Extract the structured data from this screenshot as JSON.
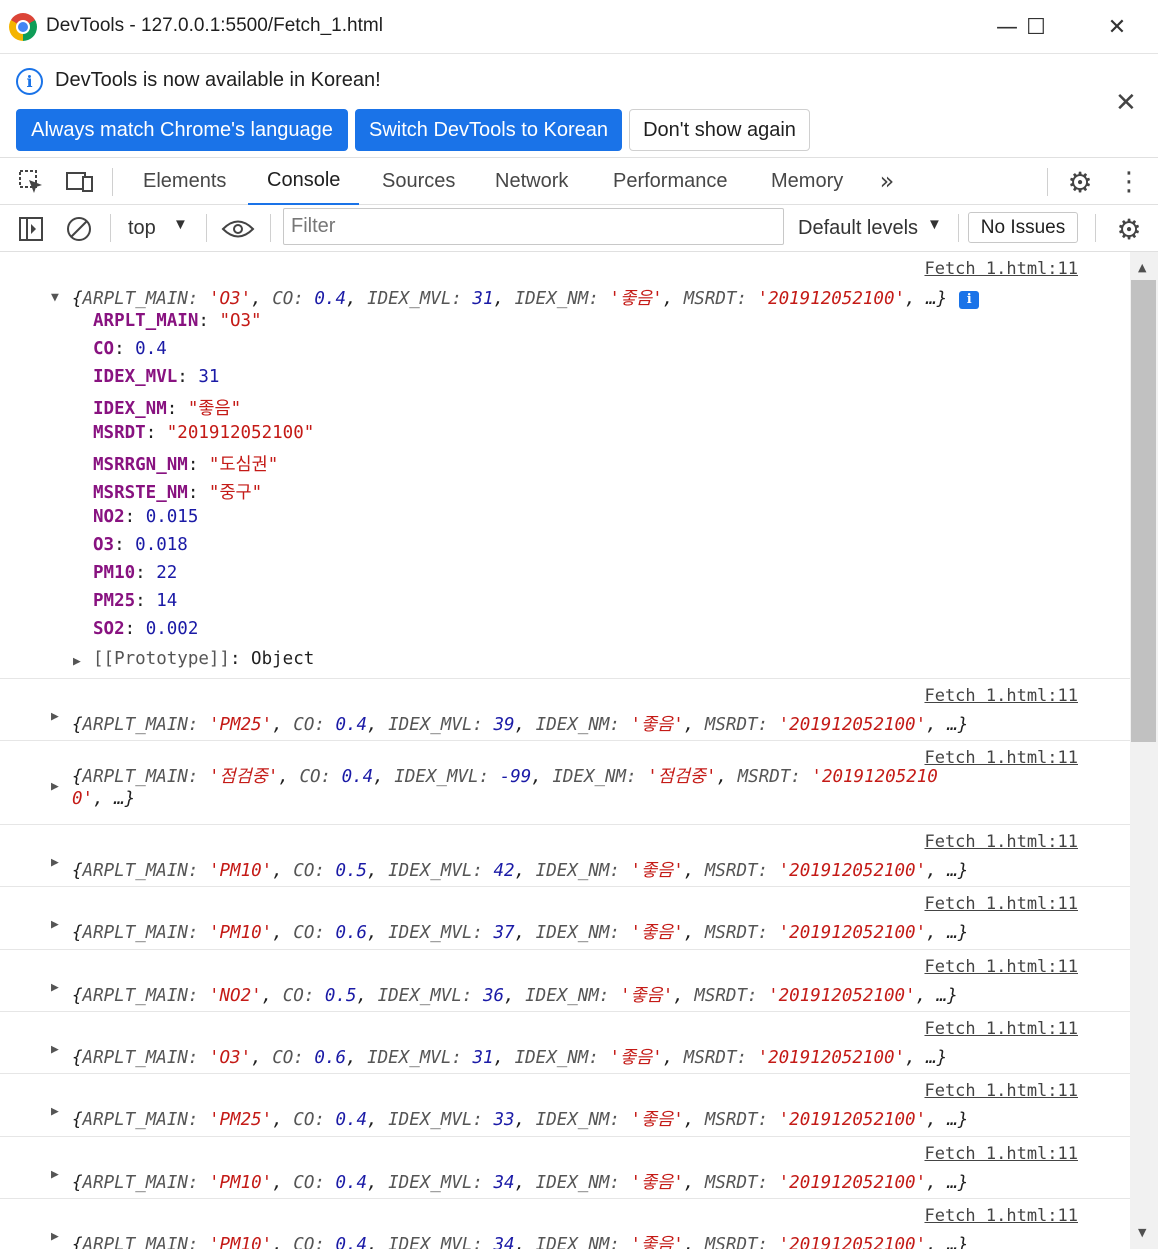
{
  "window": {
    "title": "DevTools - 127.0.0.1:5500/Fetch_1.html",
    "minimize": "—",
    "maximize": "☐",
    "close": "✕"
  },
  "infobar": {
    "message": "DevTools is now available in Korean!",
    "buttons": [
      "Always match Chrome's language",
      "Switch DevTools to Korean",
      "Don't show again"
    ],
    "close": "✕"
  },
  "tabs": [
    "Elements",
    "Console",
    "Sources",
    "Network",
    "Performance",
    "Memory"
  ],
  "active_tab": "Console",
  "console_toolbar": {
    "context": "top",
    "filter_placeholder": "Filter",
    "levels": "Default levels",
    "issues": "No Issues"
  },
  "source_link": "Fetch 1.html:11",
  "expanded": {
    "summary": {
      "ARPLT_MAIN": "'O3'",
      "CO": "0.4",
      "IDEX_MVL": "31",
      "IDEX_NM": "'좋음'",
      "MSRDT": "'201912052100'"
    },
    "props": [
      {
        "key": "ARPLT_MAIN",
        "value": "\"O3\"",
        "type": "s"
      },
      {
        "key": "CO",
        "value": "0.4",
        "type": "n"
      },
      {
        "key": "IDEX_MVL",
        "value": "31",
        "type": "n"
      },
      {
        "key": "IDEX_NM",
        "value": "\"좋음\"",
        "type": "s"
      },
      {
        "key": "MSRDT",
        "value": "\"201912052100\"",
        "type": "s"
      },
      {
        "key": "MSRRGN_NM",
        "value": "\"도심권\"",
        "type": "s"
      },
      {
        "key": "MSRSTE_NM",
        "value": "\"중구\"",
        "type": "s"
      },
      {
        "key": "NO2",
        "value": "0.015",
        "type": "n"
      },
      {
        "key": "O3",
        "value": "0.018",
        "type": "n"
      },
      {
        "key": "PM10",
        "value": "22",
        "type": "n"
      },
      {
        "key": "PM25",
        "value": "14",
        "type": "n"
      },
      {
        "key": "SO2",
        "value": "0.002",
        "type": "n"
      }
    ],
    "prototype_label": "[[Prototype]]",
    "prototype_value": "Object"
  },
  "rows": [
    {
      "main": "'PM25'",
      "co": "0.4",
      "mvl": "39",
      "nm": "'좋음'",
      "msrdt": "'201912052100'"
    },
    {
      "main": "'점검중'",
      "co": "0.4",
      "mvl": "-99",
      "nm": "'점검중'",
      "msrdt": "'20191205210",
      "msrdt_wrap": "0'",
      "wrapped": true
    },
    {
      "main": "'PM10'",
      "co": "0.5",
      "mvl": "42",
      "nm": "'좋음'",
      "msrdt": "'201912052100'"
    },
    {
      "main": "'PM10'",
      "co": "0.6",
      "mvl": "37",
      "nm": "'좋음'",
      "msrdt": "'201912052100'"
    },
    {
      "main": "'NO2'",
      "co": "0.5",
      "mvl": "36",
      "nm": "'좋음'",
      "msrdt": "'201912052100'"
    },
    {
      "main": "'O3'",
      "co": "0.6",
      "mvl": "31",
      "nm": "'좋음'",
      "msrdt": "'201912052100'"
    },
    {
      "main": "'PM25'",
      "co": "0.4",
      "mvl": "33",
      "nm": "'좋음'",
      "msrdt": "'201912052100'"
    },
    {
      "main": "'PM10'",
      "co": "0.4",
      "mvl": "34",
      "nm": "'좋음'",
      "msrdt": "'201912052100'"
    },
    {
      "main": "'PM10'",
      "co": "0.4",
      "mvl": "34",
      "nm": "'좋음'",
      "msrdt": "'201912052100'"
    }
  ],
  "keys": {
    "main": "ARPLT_MAIN",
    "co": "CO",
    "mvl": "IDEX_MVL",
    "nm": "IDEX_NM",
    "msrdt": "MSRDT"
  }
}
